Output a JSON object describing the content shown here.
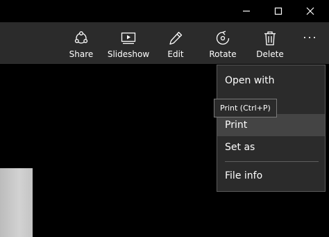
{
  "window_controls": {
    "minimize_icon": "minimize-icon",
    "maximize_icon": "maximize-icon",
    "close_icon": "close-icon"
  },
  "toolbar": {
    "share_label": "Share",
    "slideshow_label": "Slideshow",
    "edit_label": "Edit",
    "rotate_label": "Rotate",
    "delete_label": "Delete",
    "more_label": "..."
  },
  "context_menu": {
    "items": [
      {
        "label": "Open with"
      },
      {
        "label": "Print"
      },
      {
        "label": "Set as"
      },
      {
        "label": "File info"
      }
    ],
    "highlighted": "Print"
  },
  "tooltip": {
    "text": "Print (Ctrl+P)"
  },
  "colors": {
    "toolbar_bg": "#2b2b2b",
    "canvas_bg": "#000000",
    "menu_highlight": "#444444"
  }
}
